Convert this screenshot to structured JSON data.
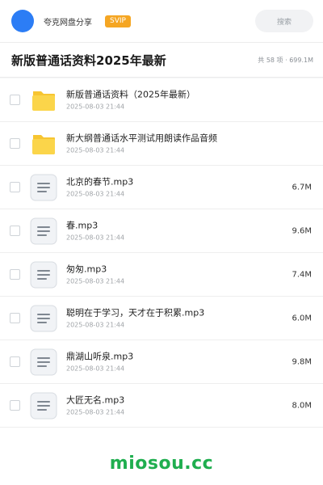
{
  "topbar": {
    "brand": "夸克网盘分享",
    "badge": "SVIP",
    "search_placeholder": "搜索",
    "colors": {
      "avatar": "#2c7df5",
      "badge": "#f5a623"
    }
  },
  "header": {
    "title": "新版普通话资料2025年最新",
    "summary": "共 58 项 · 699.1M"
  },
  "files": [
    {
      "name": "新版普通话资料（2025年最新）",
      "date": "2025-08-03 21:44",
      "size": "",
      "icon": "folder-icon"
    },
    {
      "name": "新大纲普通话水平测试用朗读作品音频",
      "date": "2025-08-03 21:44",
      "size": "",
      "icon": "folder-icon"
    },
    {
      "name": "北京的春节.mp3",
      "date": "2025-08-03 21:44",
      "size": "6.7M",
      "icon": "file-icon"
    },
    {
      "name": "春.mp3",
      "date": "2025-08-03 21:44",
      "size": "9.6M",
      "icon": "file-icon"
    },
    {
      "name": "匆匆.mp3",
      "date": "2025-08-03 21:44",
      "size": "7.4M",
      "icon": "file-icon"
    },
    {
      "name": "聪明在于学习，天才在于积累.mp3",
      "date": "2025-08-03 21:44",
      "size": "6.0M",
      "icon": "file-icon"
    },
    {
      "name": "鼎湖山听泉.mp3",
      "date": "2025-08-03 21:44",
      "size": "9.8M",
      "icon": "file-icon"
    },
    {
      "name": "大匠无名.mp3",
      "date": "2025-08-03 21:44",
      "size": "8.0M",
      "icon": "file-icon"
    }
  ],
  "footer": {
    "watermark": "miosou.cc",
    "color": "#1fae4f"
  }
}
